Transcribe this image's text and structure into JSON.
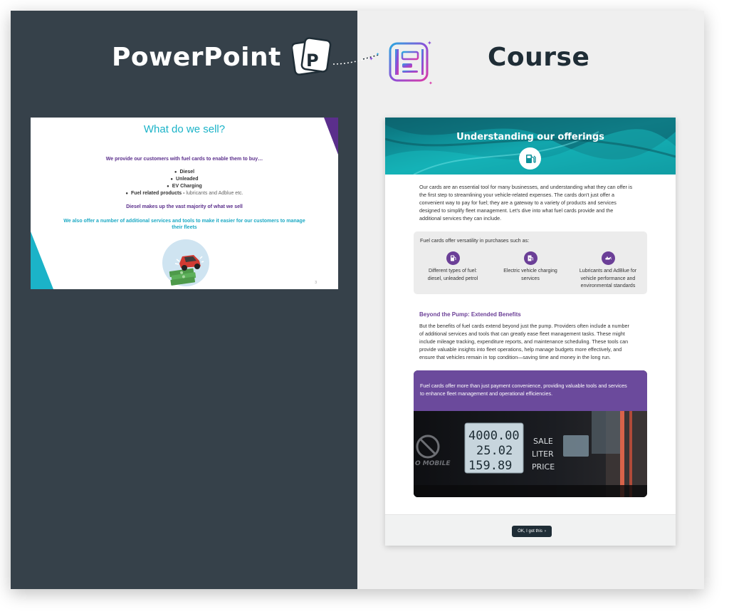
{
  "left_panel": {
    "title": "PowerPoint"
  },
  "right_panel": {
    "title": "Course"
  },
  "icons": {
    "powerpoint": "powerpoint-icon",
    "course": "course-layout-icon",
    "fuel": "fuel-pump-icon",
    "ev": "ev-charging-icon",
    "oil": "oil-can-icon",
    "chevron": "chevron-right-icon"
  },
  "colors": {
    "dark_bg": "#36414a",
    "light_bg": "#efefef",
    "teal": "#1bb3c8",
    "purple": "#6b3f97"
  },
  "slide": {
    "title": "What do we sell?",
    "intro": "We provide our customers with fuel cards to enable them to buy…",
    "items": [
      "Diesel",
      "Unleaded",
      "EV Charging"
    ],
    "related_label": "Fuel related products -",
    "related_text": " lubricants and Adblue etc.",
    "diesel_note": "Diesel makes up the vast majority of what we sell",
    "services_line1": "We also offer a number of additional services and tools to make it easier for our customers to manage",
    "services_line2": "their fleets",
    "page_number": "3"
  },
  "course": {
    "banner_title": "Understanding our offerings",
    "intro_lines": [
      "Our cards are an essential tool for many businesses, and understanding what they can offer is",
      "the first step to streamlining your vehicle-related expenses. The cards don't just offer a",
      "convenient way to pay for fuel; they are a gateway to a variety of products and services",
      "designed to simplify fleet management. Let's dive into what fuel cards provide and the",
      "additional services they can include."
    ],
    "versatility_heading": "Fuel cards offer versatility in purchases such as:",
    "versatility_items": [
      {
        "line1": "Different types of fuel:",
        "line2": "diesel, unleaded petrol",
        "line3": ""
      },
      {
        "line1": "Electric vehicle charging",
        "line2": "services",
        "line3": ""
      },
      {
        "line1": "Lubricants and AdBlue for",
        "line2": "vehicle performance and",
        "line3": "environmental standards"
      }
    ],
    "subheading": "Beyond the Pump: Extended Benefits",
    "benefits_lines": [
      "But the benefits of fuel cards extend beyond just the pump. Providers often include a number",
      "of additional services and tools that can greatly ease fleet management tasks. These might",
      "include mileage tracking, expenditure reports, and maintenance scheduling. These tools can",
      "provide valuable insights into fleet operations, help manage budgets more effectively, and",
      "ensure that vehicles remain in top condition—saving time and money in the long run."
    ],
    "callout_line1": "Fuel cards offer more than just payment convenience, providing valuable tools and services",
    "callout_line2": "to enhance fleet management and operational efficiencies.",
    "pump_display": {
      "row1": "4000.00",
      "row2": "25.02",
      "row3": "159.89",
      "labels": [
        "SALE",
        "LITER",
        "PRICE"
      ],
      "brand": "O MOBILE"
    },
    "ok_button": "OK, I got this"
  }
}
